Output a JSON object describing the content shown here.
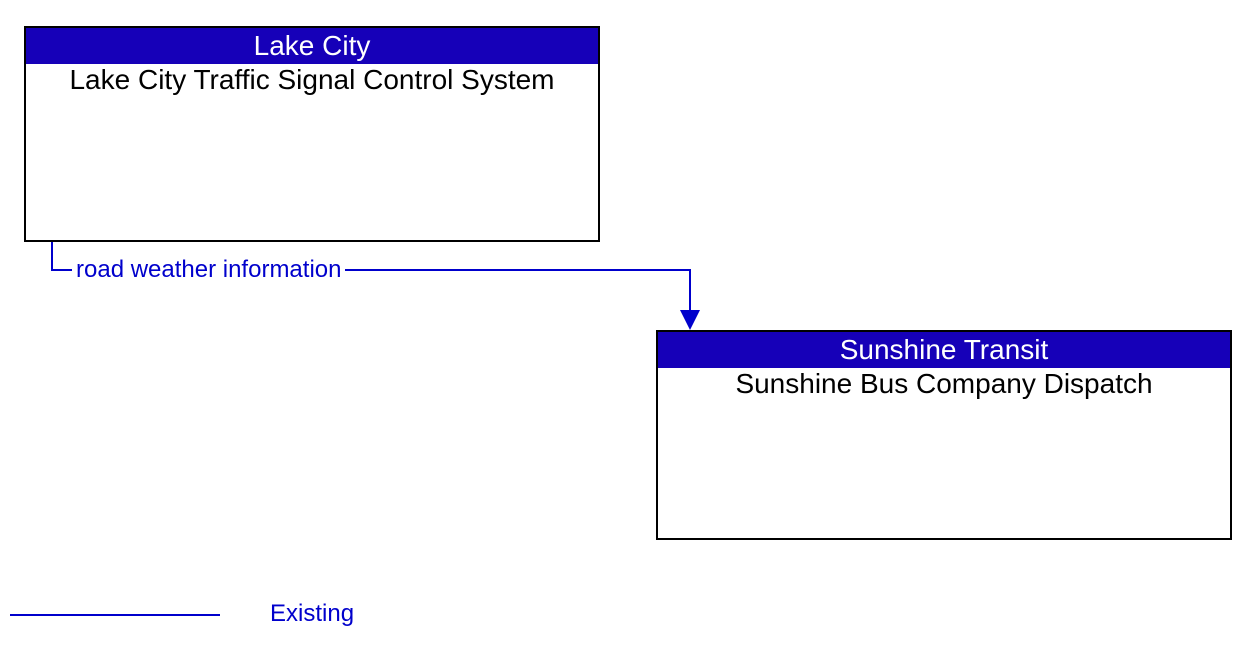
{
  "entities": {
    "source": {
      "header": "Lake City",
      "body": "Lake City Traffic Signal Control System"
    },
    "target": {
      "header": "Sunshine Transit",
      "body": "Sunshine Bus Company Dispatch"
    }
  },
  "flow": {
    "label": "road weather information"
  },
  "legend": {
    "existing": "Existing"
  },
  "colors": {
    "header_bg": "#1600b8",
    "line": "#0000cc"
  }
}
